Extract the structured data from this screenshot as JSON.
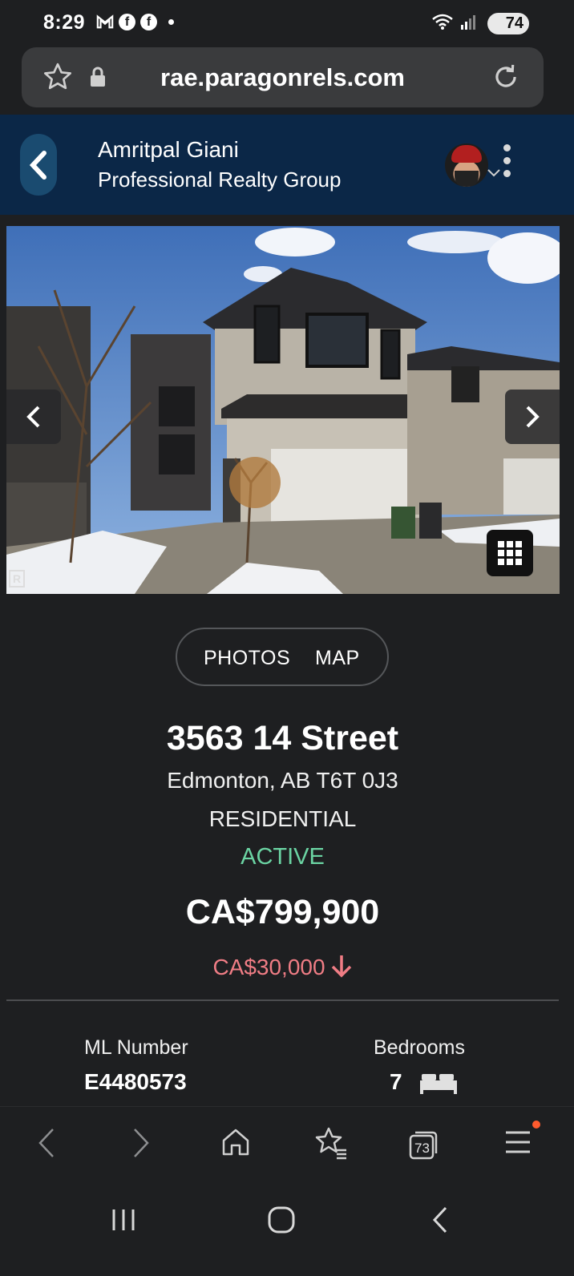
{
  "status_bar": {
    "time": "8:29",
    "battery": "74",
    "notification_icons": [
      "gmail-icon",
      "facebook-icon",
      "facebook-icon",
      "dot-icon"
    ]
  },
  "browser": {
    "url": "rae.paragonrels.com",
    "tab_count": "73"
  },
  "agent": {
    "name": "Amritpal Giani",
    "company": "Professional Realty Group"
  },
  "gallery": {
    "watermark": "R"
  },
  "toggle": {
    "photos_label": "PHOTOS",
    "map_label": "MAP"
  },
  "listing": {
    "address": "3563 14 Street",
    "city": "Edmonton, AB T6T 0J3",
    "type": "RESIDENTIAL",
    "status": "ACTIVE",
    "price": "CA$799,900",
    "price_change": "CA$30,000",
    "ml_label": "ML Number",
    "ml_value": "E4480573",
    "bedrooms_label": "Bedrooms",
    "bedrooms_value": "7"
  },
  "colors": {
    "header_bg": "#0b2747",
    "status_active": "#6bd4a3",
    "price_drop": "#f07d85",
    "page_bg": "#1e1f21"
  }
}
